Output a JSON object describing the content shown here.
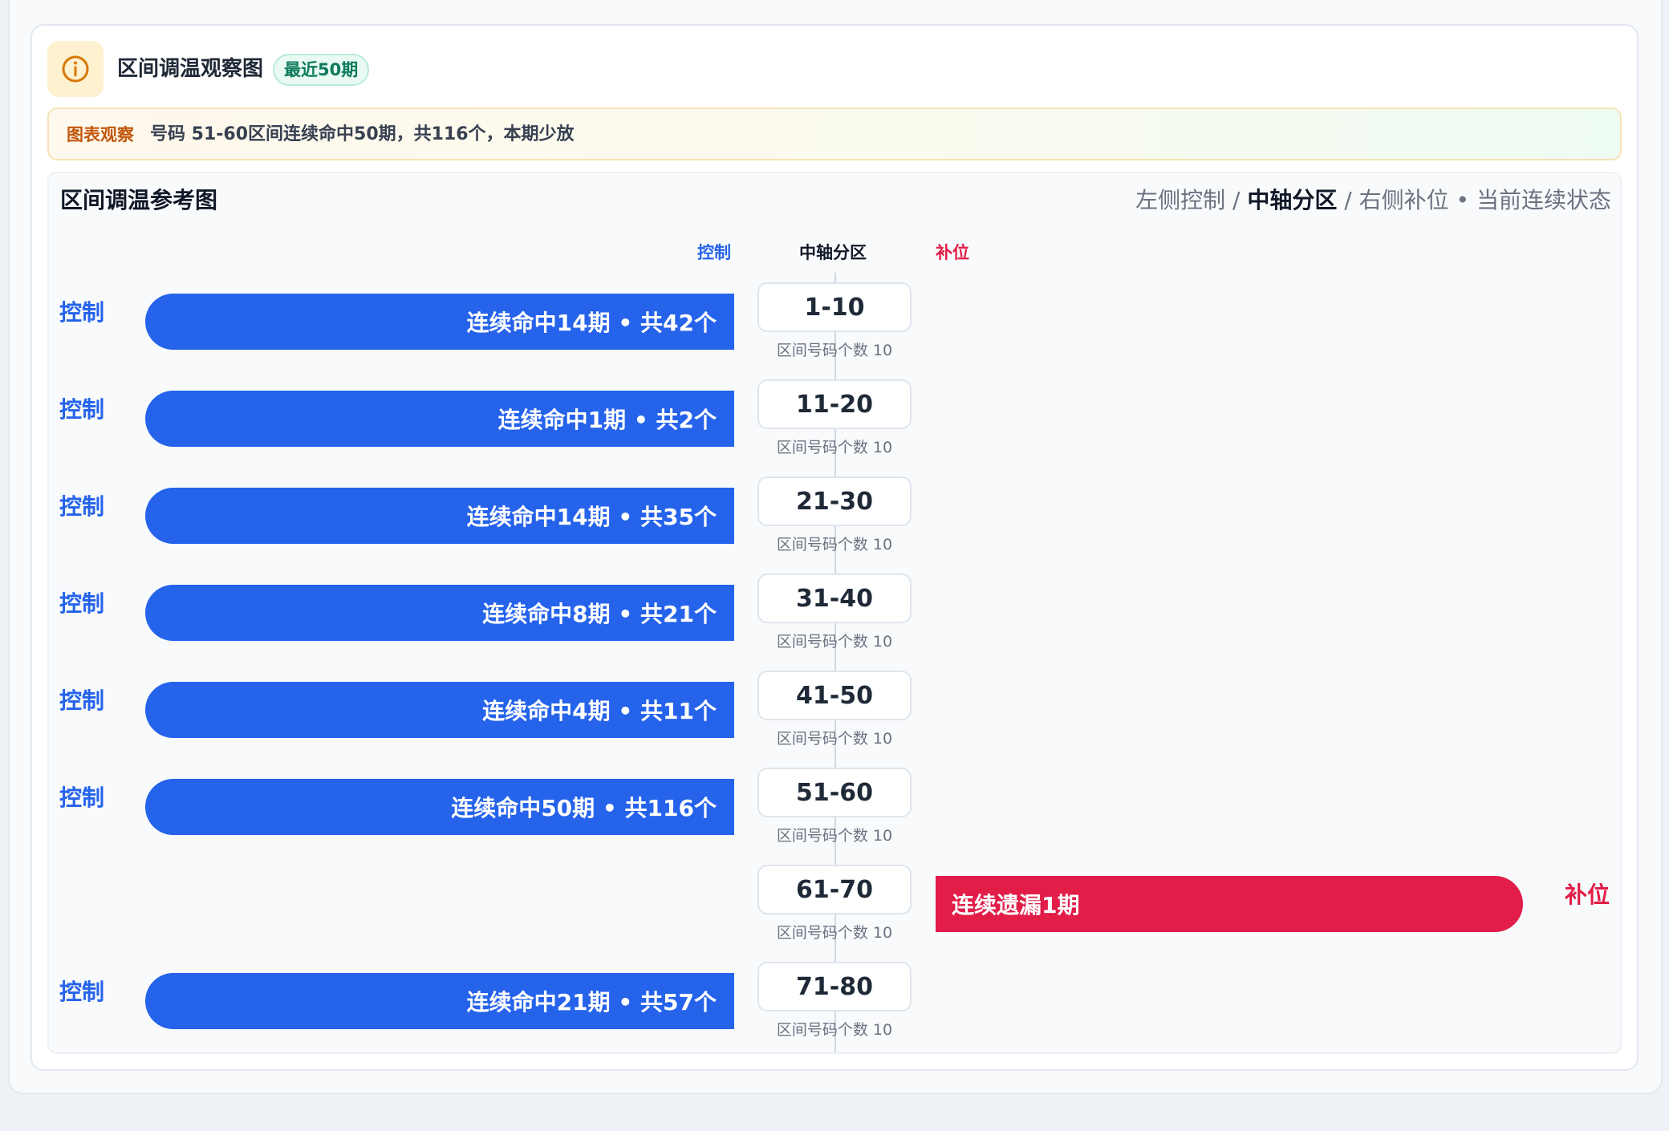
{
  "header": {
    "icon": "info-icon",
    "title": "区间调温观察图",
    "badge": "最近50期"
  },
  "notice": {
    "tag": "图表观察",
    "text": "号码 51-60区间连续命中50期，共116个，本期少放"
  },
  "panel": {
    "title": "区间调温参考图",
    "legend": {
      "left": "左侧控制",
      "sep1": " / ",
      "center": "中轴分区",
      "sep2": " / ",
      "right": "右侧补位",
      "dot": " • ",
      "state": "当前连续状态"
    },
    "columns": {
      "left": "控制",
      "center": "中轴分区",
      "right": "补位"
    }
  },
  "colors": {
    "control": "#2563eb",
    "fill": "#e11d48",
    "icon_accent": "#d97706"
  },
  "rows": [
    {
      "range": "1-10",
      "count_label": "区间号码个数 10",
      "side": "left",
      "side_label": "控制",
      "bar_label": "连续命中14期 • 共42个"
    },
    {
      "range": "11-20",
      "count_label": "区间号码个数 10",
      "side": "left",
      "side_label": "控制",
      "bar_label": "连续命中1期 • 共2个"
    },
    {
      "range": "21-30",
      "count_label": "区间号码个数 10",
      "side": "left",
      "side_label": "控制",
      "bar_label": "连续命中14期 • 共35个"
    },
    {
      "range": "31-40",
      "count_label": "区间号码个数 10",
      "side": "left",
      "side_label": "控制",
      "bar_label": "连续命中8期 • 共21个"
    },
    {
      "range": "41-50",
      "count_label": "区间号码个数 10",
      "side": "left",
      "side_label": "控制",
      "bar_label": "连续命中4期 • 共11个"
    },
    {
      "range": "51-60",
      "count_label": "区间号码个数 10",
      "side": "left",
      "side_label": "控制",
      "bar_label": "连续命中50期 • 共116个"
    },
    {
      "range": "61-70",
      "count_label": "区间号码个数 10",
      "side": "right",
      "side_label": "补位",
      "bar_label": "连续遗漏1期"
    },
    {
      "range": "71-80",
      "count_label": "区间号码个数 10",
      "side": "left",
      "side_label": "控制",
      "bar_label": "连续命中21期 • 共57个"
    }
  ]
}
